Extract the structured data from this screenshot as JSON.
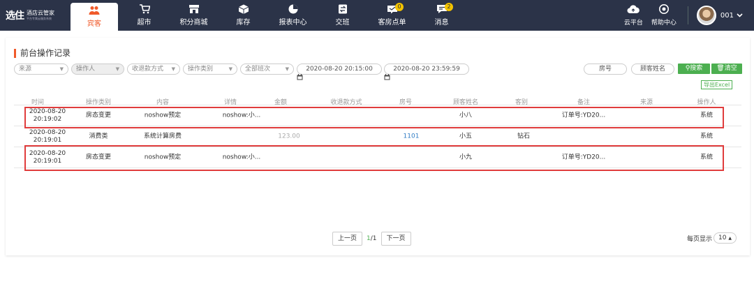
{
  "brand": {
    "logo": "选住",
    "name": "酒店云管家",
    "tagline": "平台专属云服务系统"
  },
  "nav": [
    {
      "label": "宾客",
      "icon": "guest-icon",
      "active": true
    },
    {
      "label": "超市",
      "icon": "cart-icon"
    },
    {
      "label": "积分商城",
      "icon": "store-icon"
    },
    {
      "label": "库存",
      "icon": "box-icon"
    },
    {
      "label": "报表中心",
      "icon": "pie-chart-icon"
    },
    {
      "label": "交班",
      "icon": "handover-icon"
    },
    {
      "label": "客房点单",
      "icon": "order-icon",
      "badge": "0"
    },
    {
      "label": "消息",
      "icon": "message-icon",
      "badge": "2"
    }
  ],
  "right_nav": {
    "cloud": "云平台",
    "help": "帮助中心",
    "user": "001"
  },
  "page": {
    "title": "前台操作记录"
  },
  "filters": {
    "source": "来源",
    "operator": "操作人",
    "refund_method": "收退款方式",
    "op_type": "操作类别",
    "shift": "全部班次",
    "start": "2020-08-20 20:15:00",
    "end": "2020-08-20 23:59:59",
    "room": "房号",
    "guest": "顾客姓名",
    "search": "搜索",
    "clear": "清空",
    "export": "导出Excel"
  },
  "table": {
    "headers": [
      "时间",
      "操作类别",
      "内容",
      "详情",
      "金额",
      "收退款方式",
      "房号",
      "顾客姓名",
      "客别",
      "备注",
      "来源",
      "操作人"
    ],
    "rows": [
      {
        "date": "2020-08-20",
        "time": "20:19:02",
        "type": "房态变更",
        "content": "noshow预定",
        "detail": "noshow:小...",
        "amount": "",
        "method": "",
        "room": "",
        "guest": "小八",
        "level": "",
        "note": "订单号:YD20...",
        "source": "",
        "operator": "系统"
      },
      {
        "date": "2020-08-20",
        "time": "20:19:01",
        "type": "消费类",
        "content": "系统计算房费",
        "detail": "",
        "amount": "123.00",
        "method": "",
        "room": "1101",
        "guest": "小五",
        "level": "钻石",
        "note": "",
        "source": "",
        "operator": "系统"
      },
      {
        "date": "2020-08-20",
        "time": "20:19:01",
        "type": "房态变更",
        "content": "noshow预定",
        "detail": "noshow:小...",
        "amount": "",
        "method": "",
        "room": "",
        "guest": "小九",
        "level": "",
        "note": "订单号:YD20...",
        "source": "",
        "operator": "系统"
      }
    ]
  },
  "pager": {
    "prev": "上一页",
    "current": "1",
    "sep": "/",
    "total": "1",
    "next": "下一页",
    "per_page_label": "每页显示",
    "per_page": "10"
  },
  "colors": {
    "accent": "#f05a2a",
    "green": "#4caf50",
    "highlight": "#e03c3c",
    "nav_bg": "#2b3348"
  }
}
